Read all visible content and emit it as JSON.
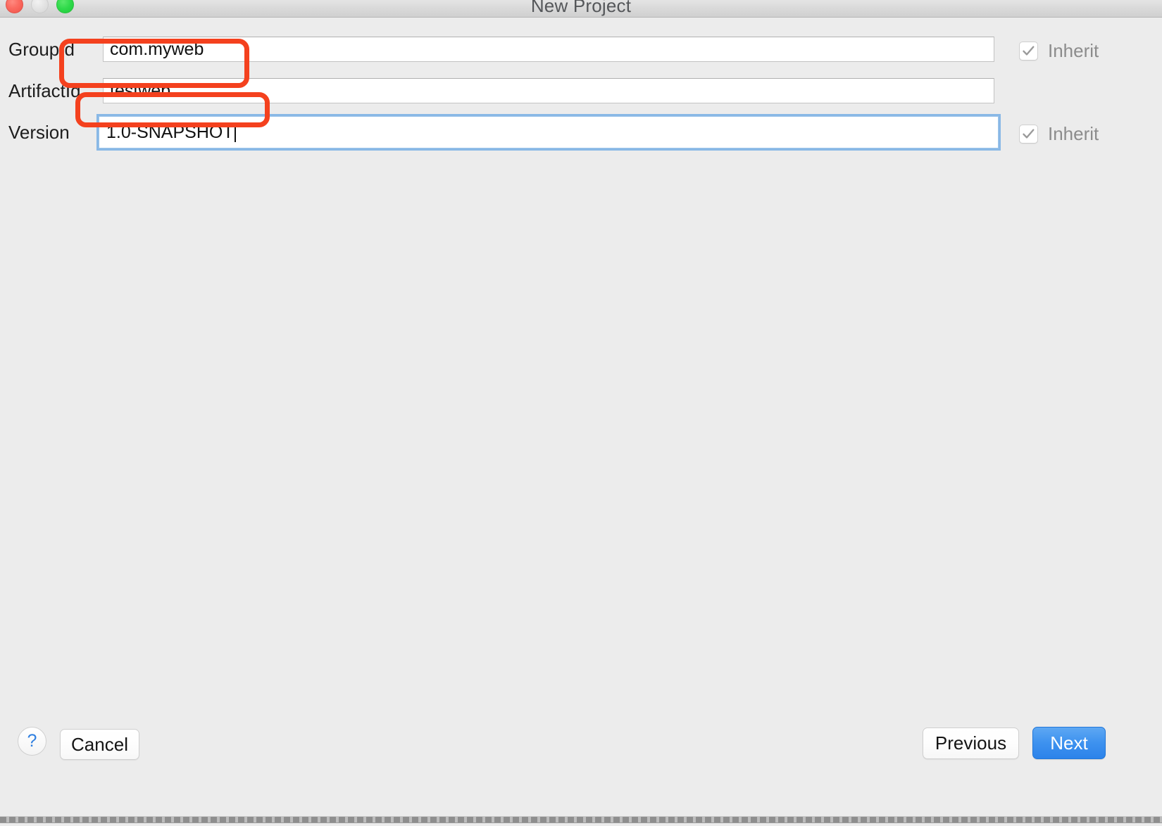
{
  "window": {
    "title": "New Project",
    "traffic_lights": [
      {
        "name": "close",
        "color": "#fb6a60"
      },
      {
        "name": "minimize",
        "color": "#e3e3e3"
      },
      {
        "name": "zoom",
        "color": "#2fd94a"
      }
    ]
  },
  "form": {
    "rows": [
      {
        "label": "GroupId",
        "value": "com.myweb",
        "placeholder": "",
        "focused": false,
        "inherit": {
          "label": "Inherit",
          "checked": true,
          "enabled": false
        }
      },
      {
        "label": "ArtifactId",
        "value": "testweb",
        "placeholder": "",
        "focused": false,
        "inherit": null
      },
      {
        "label": "Version",
        "value": "1.0-SNAPSHOT",
        "placeholder": "",
        "focused": true,
        "inherit": {
          "label": "Inherit",
          "checked": true,
          "enabled": false
        }
      }
    ]
  },
  "annotations": {
    "color": "#f4411e",
    "boxes": [
      {
        "target": "groupid-field"
      },
      {
        "target": "artifactid-field"
      }
    ]
  },
  "footer": {
    "help_label": "?",
    "cancel_label": "Cancel",
    "previous_label": "Previous",
    "next_label": "Next",
    "next_accent": "#2c83ea"
  }
}
